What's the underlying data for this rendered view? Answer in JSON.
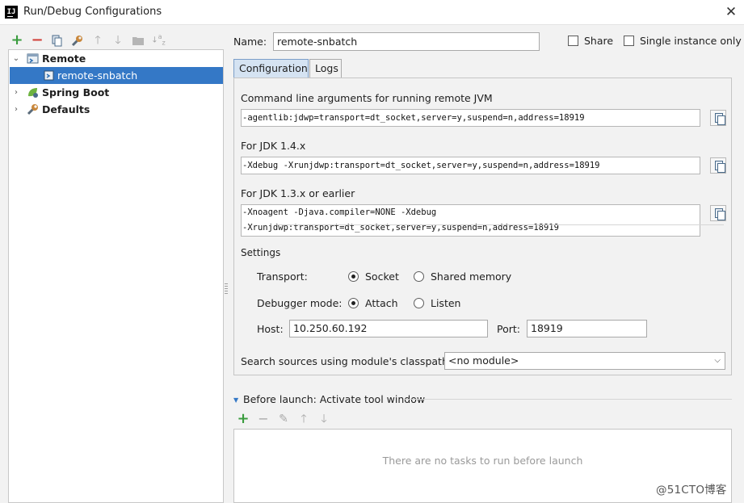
{
  "window": {
    "title": "Run/Debug Configurations"
  },
  "toolbar": {
    "icons": [
      "plus-icon",
      "minus-icon",
      "copy-icon",
      "wrench-icon",
      "arrow-up-icon",
      "arrow-down-icon",
      "folder-icon",
      "sort-az-icon"
    ]
  },
  "tree": {
    "remote_label": "Remote",
    "remote_child_label": "remote-snbatch",
    "spring_boot_label": "Spring Boot",
    "defaults_label": "Defaults"
  },
  "form": {
    "name_label": "Name:",
    "name_value": "remote-snbatch",
    "share_label": "Share",
    "single_instance_label": "Single instance only"
  },
  "tabs": {
    "configuration": "Configuration",
    "logs": "Logs"
  },
  "config": {
    "cmd_label": "Command line arguments for running remote JVM",
    "cmd_value": "-agentlib:jdwp=transport=dt_socket,server=y,suspend=n,address=18919",
    "jdk14_label": "For JDK 1.4.x",
    "jdk14_value": "-Xdebug -Xrunjdwp:transport=dt_socket,server=y,suspend=n,address=18919",
    "jdk13_label": "For JDK 1.3.x or earlier",
    "jdk13_line1": "-Xnoagent -Djava.compiler=NONE -Xdebug",
    "jdk13_line2": "-Xrunjdwp:transport=dt_socket,server=y,suspend=n,address=18919",
    "settings_label": "Settings",
    "transport_label": "Transport:",
    "transport_socket": "Socket",
    "transport_shared": "Shared memory",
    "debugger_mode_label": "Debugger mode:",
    "mode_attach": "Attach",
    "mode_listen": "Listen",
    "host_label": "Host:",
    "host_value": "10.250.60.192",
    "port_label": "Port:",
    "port_value": "18919",
    "classpath_label": "Search sources using module's classpath:",
    "classpath_value": "<no module>"
  },
  "before_launch": {
    "title": "Before launch: Activate tool window",
    "empty_text": "There are no tasks to run before launch"
  },
  "watermark": "@51CTO博客"
}
